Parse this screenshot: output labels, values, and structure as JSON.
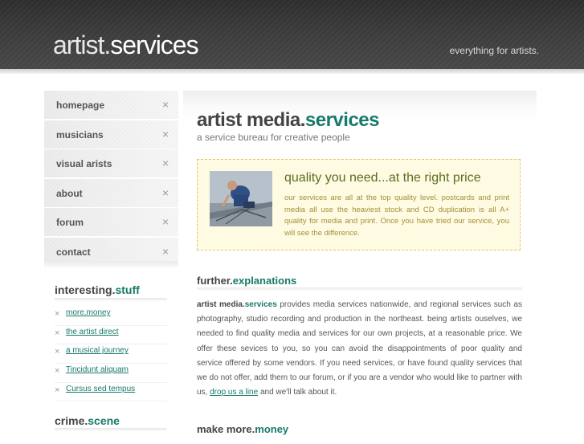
{
  "header": {
    "logo_part1": "artist.",
    "logo_part2": "services",
    "tagline": "everything for artists."
  },
  "nav": {
    "items": [
      {
        "label": "homepage"
      },
      {
        "label": "musicians"
      },
      {
        "label": "visual arists"
      },
      {
        "label": "about"
      },
      {
        "label": "forum"
      },
      {
        "label": "contact"
      }
    ],
    "close_glyph": "×"
  },
  "sidebar": {
    "interesting_part1": "interesting.",
    "interesting_part2": "stuff",
    "links": [
      {
        "label": "more.money"
      },
      {
        "label": "the artist direct"
      },
      {
        "label": "a musical journey"
      },
      {
        "label": "Tincidunt aliquam"
      },
      {
        "label": "Cursus sed tempus"
      }
    ],
    "crime_part1": "crime.",
    "crime_part2": "scene"
  },
  "main": {
    "title_part1": "artist media.",
    "title_part2": "services",
    "subtitle": "a service bureau for creative people",
    "feature": {
      "title": "quality you need...at the right price",
      "text": "our services are all at the top quality level. postcards and print media all use the heaviest stock and CD duplication is all A+ quality for media and print. Once you have tried our service, you will see the difference."
    },
    "further_part1": "further.",
    "further_part2": "explanations",
    "para_bold1": "artist media.",
    "para_bold2": "services",
    "para_text": " provides media services nationwide, and regional services such as photography, studio recording and production in the northeast. being artists ouselves, we needed to find quality media and services for our own projects, at a reasonable price. We offer these sevices to you, so you can avoid the disappointments of poor quality and service offered by some vendors. If you need services, or have found quality services that we do not offer, add them to our forum, or if you are a vendor who would like to partner with us, ",
    "para_link": "drop us a line",
    "para_end": " and we'll talk about it.",
    "money_part1": "make more.",
    "money_part2": "money"
  },
  "colors": {
    "accent": "#177a6a",
    "header_bg": "#333333",
    "feature_bg": "#fffbe3",
    "feature_title": "#5b6d1e"
  }
}
